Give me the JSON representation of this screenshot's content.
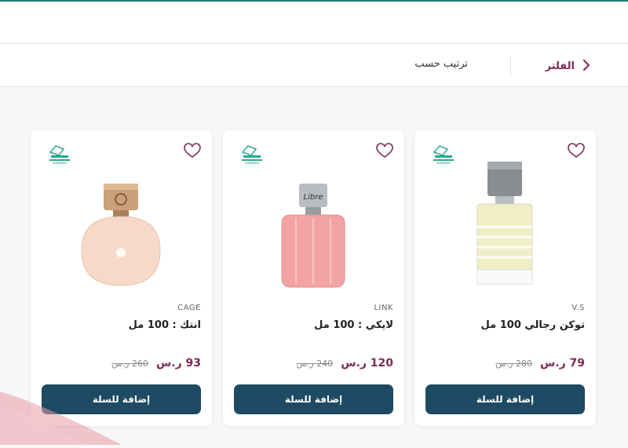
{
  "toolbar": {
    "filter_label": "الفلتر",
    "sort_label": "ترتيب حسب"
  },
  "products": [
    {
      "brand": "V.S",
      "title": "توكن رجالي 100 مل",
      "price": "79 ر.س",
      "old_price": "280 ر.س",
      "add_to_cart": "إضافة للسلة",
      "bottle_color": "#efeec6",
      "cap_color": "#8a8d90"
    },
    {
      "brand": "LINK",
      "title": "لايكي : 100 مل",
      "price": "120 ر.س",
      "old_price": "240 ر.س",
      "add_to_cart": "إضافة للسلة",
      "bottle_color": "#f3a3a3",
      "cap_color": "#b9bcc0"
    },
    {
      "brand": "CAGE",
      "title": "انتك : 100 مل",
      "price": "93 ر.س",
      "old_price": "260 ر.س",
      "add_to_cart": "إضافة للسلة",
      "bottle_color": "#f6d9c9",
      "cap_color": "#c9a07a"
    }
  ],
  "colors": {
    "accent": "#7b2a55",
    "button": "#1e4a63",
    "top_line": "#1c7a6c"
  }
}
